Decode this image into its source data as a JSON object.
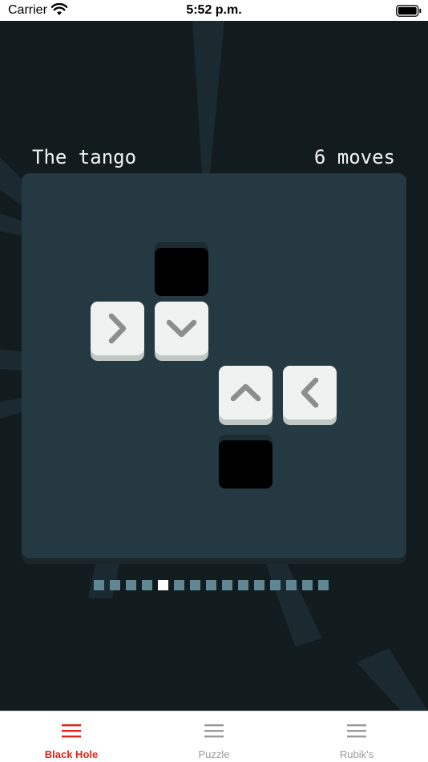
{
  "status_bar": {
    "carrier": "Carrier",
    "time": "5:52 p.m.",
    "icons": [
      "wifi-icon",
      "battery-icon"
    ]
  },
  "level": {
    "title": "The tango",
    "moves": "6 moves"
  },
  "board": {
    "tiles": [
      {
        "direction": "right",
        "icon": "arrow-right-icon"
      },
      {
        "direction": "down",
        "icon": "arrow-down-icon"
      },
      {
        "direction": "up",
        "icon": "arrow-up-icon"
      },
      {
        "direction": "left",
        "icon": "arrow-left-icon"
      }
    ],
    "holes": 2
  },
  "pager": {
    "total": 15,
    "current": 5
  },
  "tabs": [
    {
      "label": "Black Hole",
      "icon": "menu-icon",
      "active": true
    },
    {
      "label": "Puzzle",
      "icon": "menu-icon",
      "active": false
    },
    {
      "label": "Rubik's",
      "icon": "menu-icon",
      "active": false
    }
  ],
  "colors": {
    "accent": "#e0231a",
    "background": "#121b1d",
    "board": "#243941",
    "tile": "#eef2f1",
    "arrow": "#8a8f8d",
    "pager_dot": "#5f8793"
  }
}
